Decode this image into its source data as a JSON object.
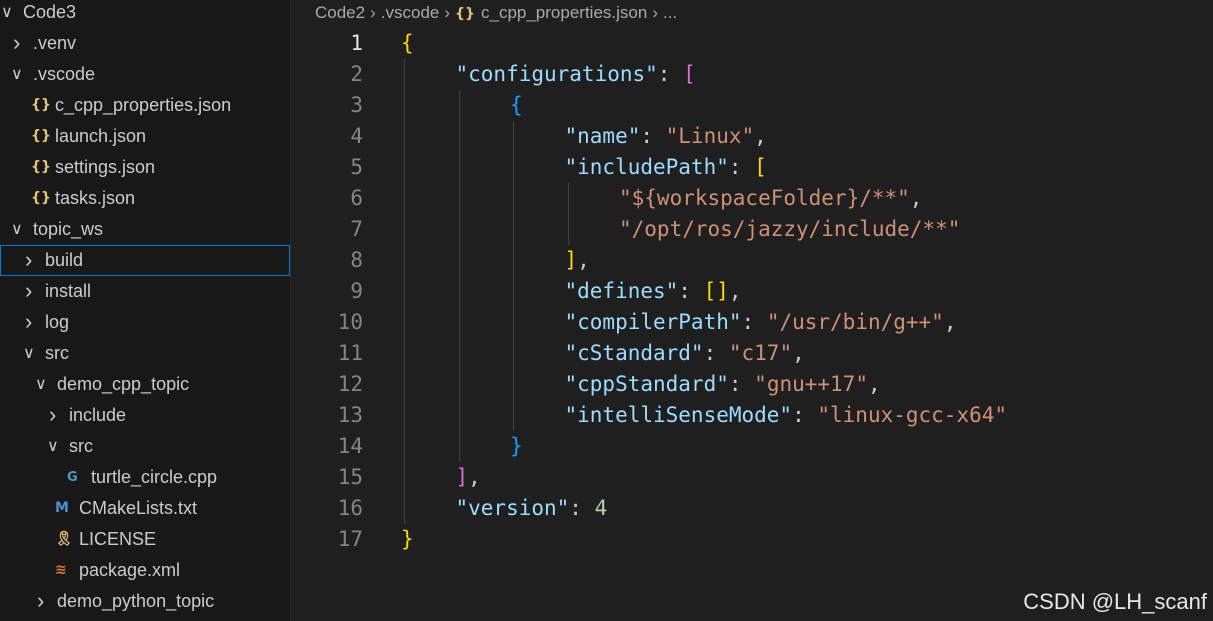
{
  "explorer": {
    "items": [
      {
        "label": "Code3",
        "chevron": "down",
        "icon": null,
        "depth": 0
      },
      {
        "label": ".venv",
        "chevron": "right",
        "icon": null,
        "depth": 1
      },
      {
        "label": ".vscode",
        "chevron": "down",
        "icon": null,
        "depth": 1
      },
      {
        "label": "c_cpp_properties.json",
        "chevron": null,
        "icon": "json-braces-icon",
        "depth": 2
      },
      {
        "label": "launch.json",
        "chevron": null,
        "icon": "json-braces-icon",
        "depth": 2
      },
      {
        "label": "settings.json",
        "chevron": null,
        "icon": "json-braces-icon",
        "depth": 2
      },
      {
        "label": "tasks.json",
        "chevron": null,
        "icon": "json-braces-icon",
        "depth": 2
      },
      {
        "label": "topic_ws",
        "chevron": "down",
        "icon": null,
        "depth": 1
      },
      {
        "label": "build",
        "chevron": "right",
        "icon": null,
        "depth": 2,
        "selected": true
      },
      {
        "label": "install",
        "chevron": "right",
        "icon": null,
        "depth": 2
      },
      {
        "label": "log",
        "chevron": "right",
        "icon": null,
        "depth": 2
      },
      {
        "label": "src",
        "chevron": "down",
        "icon": null,
        "depth": 2
      },
      {
        "label": "demo_cpp_topic",
        "chevron": "down",
        "icon": null,
        "depth": 3
      },
      {
        "label": "include",
        "chevron": "right",
        "icon": null,
        "depth": 4
      },
      {
        "label": "src",
        "chevron": "down",
        "icon": null,
        "depth": 4
      },
      {
        "label": "turtle_circle.cpp",
        "chevron": null,
        "icon": "cpp-file-icon",
        "depth": 5
      },
      {
        "label": "CMakeLists.txt",
        "chevron": null,
        "icon": "cmake-file-icon",
        "depth": 4
      },
      {
        "label": "LICENSE",
        "chevron": null,
        "icon": "license-file-icon",
        "depth": 4
      },
      {
        "label": "package.xml",
        "chevron": null,
        "icon": "rss-xml-file-icon",
        "depth": 4
      },
      {
        "label": "demo_python_topic",
        "chevron": "right",
        "icon": null,
        "depth": 3
      }
    ]
  },
  "breadcrumb": {
    "segments": [
      "Code2",
      ".vscode",
      "c_cpp_properties.json",
      "..."
    ]
  },
  "editor": {
    "active_line": 1,
    "lines": [
      {
        "n": "1",
        "indent": 0,
        "tokens": [
          [
            "b1",
            "{"
          ]
        ]
      },
      {
        "n": "2",
        "indent": 1,
        "tokens": [
          [
            "key",
            "\"configurations\""
          ],
          [
            "p",
            ": "
          ],
          [
            "b2",
            "["
          ]
        ]
      },
      {
        "n": "3",
        "indent": 2,
        "tokens": [
          [
            "b3",
            "{"
          ]
        ]
      },
      {
        "n": "4",
        "indent": 3,
        "tokens": [
          [
            "key",
            "\"name\""
          ],
          [
            "p",
            ": "
          ],
          [
            "str",
            "\"Linux\""
          ],
          [
            "p",
            ","
          ]
        ]
      },
      {
        "n": "5",
        "indent": 3,
        "tokens": [
          [
            "key",
            "\"includePath\""
          ],
          [
            "p",
            ": "
          ],
          [
            "b1",
            "["
          ]
        ]
      },
      {
        "n": "6",
        "indent": 4,
        "tokens": [
          [
            "str",
            "\"${workspaceFolder}/**\""
          ],
          [
            "p",
            ","
          ]
        ]
      },
      {
        "n": "7",
        "indent": 4,
        "tokens": [
          [
            "str",
            "\"/opt/ros/jazzy/include/**\""
          ]
        ]
      },
      {
        "n": "8",
        "indent": 3,
        "tokens": [
          [
            "b1",
            "]"
          ],
          [
            "p",
            ","
          ]
        ]
      },
      {
        "n": "9",
        "indent": 3,
        "tokens": [
          [
            "key",
            "\"defines\""
          ],
          [
            "p",
            ": "
          ],
          [
            "b1",
            "[]"
          ],
          [
            "p",
            ","
          ]
        ]
      },
      {
        "n": "10",
        "indent": 3,
        "tokens": [
          [
            "key",
            "\"compilerPath\""
          ],
          [
            "p",
            ": "
          ],
          [
            "str",
            "\"/usr/bin/g++\""
          ],
          [
            "p",
            ","
          ]
        ]
      },
      {
        "n": "11",
        "indent": 3,
        "tokens": [
          [
            "key",
            "\"cStandard\""
          ],
          [
            "p",
            ": "
          ],
          [
            "str",
            "\"c17\""
          ],
          [
            "p",
            ","
          ]
        ]
      },
      {
        "n": "12",
        "indent": 3,
        "tokens": [
          [
            "key",
            "\"cppStandard\""
          ],
          [
            "p",
            ": "
          ],
          [
            "str",
            "\"gnu++17\""
          ],
          [
            "p",
            ","
          ]
        ]
      },
      {
        "n": "13",
        "indent": 3,
        "tokens": [
          [
            "key",
            "\"intelliSenseMode\""
          ],
          [
            "p",
            ": "
          ],
          [
            "str",
            "\"linux-gcc-x64\""
          ]
        ]
      },
      {
        "n": "14",
        "indent": 2,
        "tokens": [
          [
            "b3",
            "}"
          ]
        ]
      },
      {
        "n": "15",
        "indent": 1,
        "tokens": [
          [
            "b2",
            "]"
          ],
          [
            "p",
            ","
          ]
        ]
      },
      {
        "n": "16",
        "indent": 1,
        "tokens": [
          [
            "key",
            "\"version\""
          ],
          [
            "p",
            ": "
          ],
          [
            "num",
            "4"
          ]
        ]
      },
      {
        "n": "17",
        "indent": 0,
        "tokens": [
          [
            "b1",
            "}"
          ]
        ]
      }
    ]
  },
  "watermark": "CSDN @LH_scanf",
  "colors": {
    "json_icon": "#e5c07b",
    "cpp_icon": "#519aba",
    "cmake_icon": "#4d8fd6",
    "license_icon": "#e5c07b",
    "xml_icon": "#e37933",
    "selection_border": "#0078d4"
  }
}
